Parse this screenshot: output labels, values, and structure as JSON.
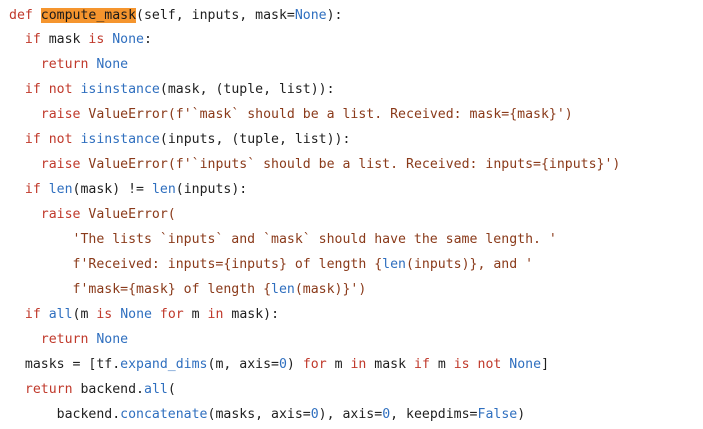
{
  "code_lines": [
    [
      {
        "t": "def ",
        "c": "kw"
      },
      {
        "t": "compute_mask",
        "c": "hl"
      },
      {
        "t": "(self, inputs, mask=",
        "c": "op"
      },
      {
        "t": "None",
        "c": "cn"
      },
      {
        "t": "):",
        "c": "op"
      }
    ],
    [
      {
        "t": "  if ",
        "c": "kw"
      },
      {
        "t": "mask ",
        "c": "op"
      },
      {
        "t": "is ",
        "c": "kw"
      },
      {
        "t": "None",
        "c": "cn"
      },
      {
        "t": ":",
        "c": "op"
      }
    ],
    [
      {
        "t": "    return ",
        "c": "kw"
      },
      {
        "t": "None",
        "c": "cn"
      }
    ],
    [
      {
        "t": "  if not ",
        "c": "kw"
      },
      {
        "t": "isinstance",
        "c": "bi"
      },
      {
        "t": "(mask, (tuple, list)):",
        "c": "op"
      }
    ],
    [
      {
        "t": "    raise ",
        "c": "kw"
      },
      {
        "t": "ValueError",
        "c": "st"
      },
      {
        "t": "(f'`mask` should be a list. Received: mask={mask}')",
        "c": "st"
      }
    ],
    [
      {
        "t": "  if not ",
        "c": "kw"
      },
      {
        "t": "isinstance",
        "c": "bi"
      },
      {
        "t": "(inputs, (tuple, list)):",
        "c": "op"
      }
    ],
    [
      {
        "t": "    raise ",
        "c": "kw"
      },
      {
        "t": "ValueError",
        "c": "st"
      },
      {
        "t": "(f'`inputs` should be a list. Received: inputs={inputs}')",
        "c": "st"
      }
    ],
    [
      {
        "t": "  if ",
        "c": "kw"
      },
      {
        "t": "len",
        "c": "bi"
      },
      {
        "t": "(mask) != ",
        "c": "op"
      },
      {
        "t": "len",
        "c": "bi"
      },
      {
        "t": "(inputs):",
        "c": "op"
      }
    ],
    [
      {
        "t": "    raise ",
        "c": "kw"
      },
      {
        "t": "ValueError(",
        "c": "st"
      }
    ],
    [
      {
        "t": "        'The lists `inputs` and `mask` should have the same length. '",
        "c": "st"
      }
    ],
    [
      {
        "t": "        f'Received: inputs={inputs} of length {",
        "c": "st"
      },
      {
        "t": "len",
        "c": "bi"
      },
      {
        "t": "(inputs)}, and '",
        "c": "st"
      }
    ],
    [
      {
        "t": "        f'mask={mask} of length {",
        "c": "st"
      },
      {
        "t": "len",
        "c": "bi"
      },
      {
        "t": "(mask)}')",
        "c": "st"
      }
    ],
    [
      {
        "t": "  if ",
        "c": "kw"
      },
      {
        "t": "all",
        "c": "bi"
      },
      {
        "t": "(m ",
        "c": "op"
      },
      {
        "t": "is ",
        "c": "kw"
      },
      {
        "t": "None ",
        "c": "cn"
      },
      {
        "t": "for ",
        "c": "kw"
      },
      {
        "t": "m ",
        "c": "op"
      },
      {
        "t": "in ",
        "c": "kw"
      },
      {
        "t": "mask):",
        "c": "op"
      }
    ],
    [
      {
        "t": "    return ",
        "c": "kw"
      },
      {
        "t": "None",
        "c": "cn"
      }
    ],
    [
      {
        "t": "  masks = [tf.",
        "c": "op"
      },
      {
        "t": "expand_dims",
        "c": "bi"
      },
      {
        "t": "(m, axis=",
        "c": "op"
      },
      {
        "t": "0",
        "c": "num"
      },
      {
        "t": ") ",
        "c": "op"
      },
      {
        "t": "for ",
        "c": "kw"
      },
      {
        "t": "m ",
        "c": "op"
      },
      {
        "t": "in ",
        "c": "kw"
      },
      {
        "t": "mask ",
        "c": "op"
      },
      {
        "t": "if ",
        "c": "kw"
      },
      {
        "t": "m ",
        "c": "op"
      },
      {
        "t": "is not ",
        "c": "kw"
      },
      {
        "t": "None",
        "c": "cn"
      },
      {
        "t": "]",
        "c": "op"
      }
    ],
    [
      {
        "t": "  return ",
        "c": "kw"
      },
      {
        "t": "backend.",
        "c": "op"
      },
      {
        "t": "all",
        "c": "bi"
      },
      {
        "t": "(",
        "c": "op"
      }
    ],
    [
      {
        "t": "      backend.",
        "c": "op"
      },
      {
        "t": "concatenate",
        "c": "bi"
      },
      {
        "t": "(masks, axis=",
        "c": "op"
      },
      {
        "t": "0",
        "c": "num"
      },
      {
        "t": "), axis=",
        "c": "op"
      },
      {
        "t": "0",
        "c": "num"
      },
      {
        "t": ", keepdims=",
        "c": "op"
      },
      {
        "t": "False",
        "c": "cn"
      },
      {
        "t": ")",
        "c": "op"
      }
    ]
  ]
}
